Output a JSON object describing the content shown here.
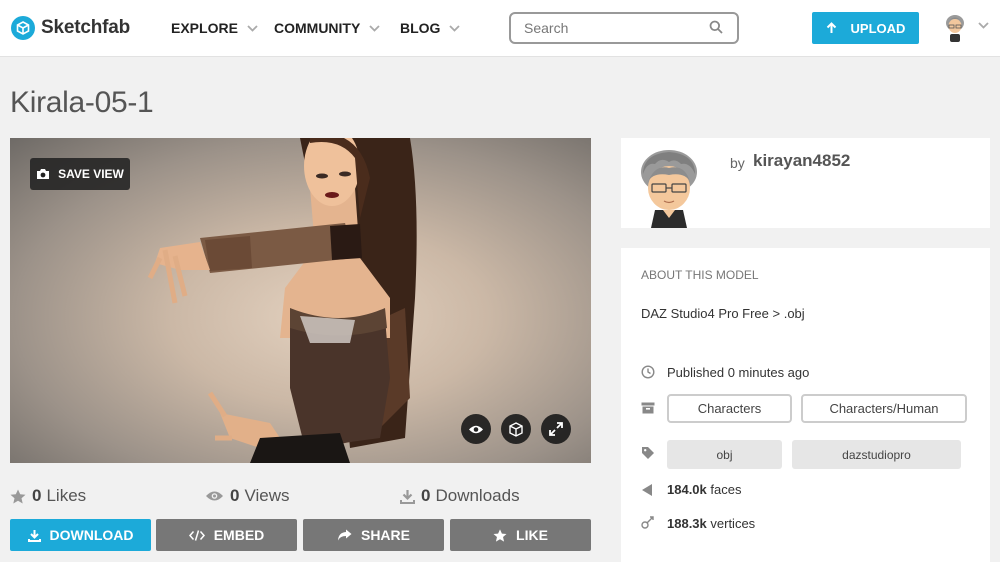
{
  "header": {
    "logo_text": "Sketchfab",
    "nav": [
      {
        "label": "EXPLORE"
      },
      {
        "label": "COMMUNITY"
      },
      {
        "label": "BLOG"
      }
    ],
    "search_placeholder": "Search",
    "upload_label": "UPLOAD"
  },
  "model": {
    "title": "Kirala-05-1",
    "viewer": {
      "save_view_label": "SAVE VIEW"
    },
    "stats": {
      "likes_count": "0",
      "likes_label": "Likes",
      "views_count": "0",
      "views_label": "Views",
      "downloads_count": "0",
      "downloads_label": "Downloads"
    },
    "actions": {
      "download": "DOWNLOAD",
      "embed": "EMBED",
      "share": "SHARE",
      "like": "LIKE"
    }
  },
  "author": {
    "by_label": "by",
    "name": "kirayan4852"
  },
  "about": {
    "title": "ABOUT THIS MODEL",
    "description": "DAZ Studio4 Pro Free > .obj",
    "published": "Published 0 minutes ago",
    "categories": [
      "Characters",
      "Characters/Human"
    ],
    "tags": [
      "obj",
      "dazstudiopro"
    ],
    "faces_value": "184.0k",
    "faces_label": "faces",
    "vertices_value": "188.3k",
    "vertices_label": "vertices"
  },
  "colors": {
    "accent": "#1caad9",
    "secondary_button": "#777777",
    "page_background": "#f1f1f1"
  }
}
